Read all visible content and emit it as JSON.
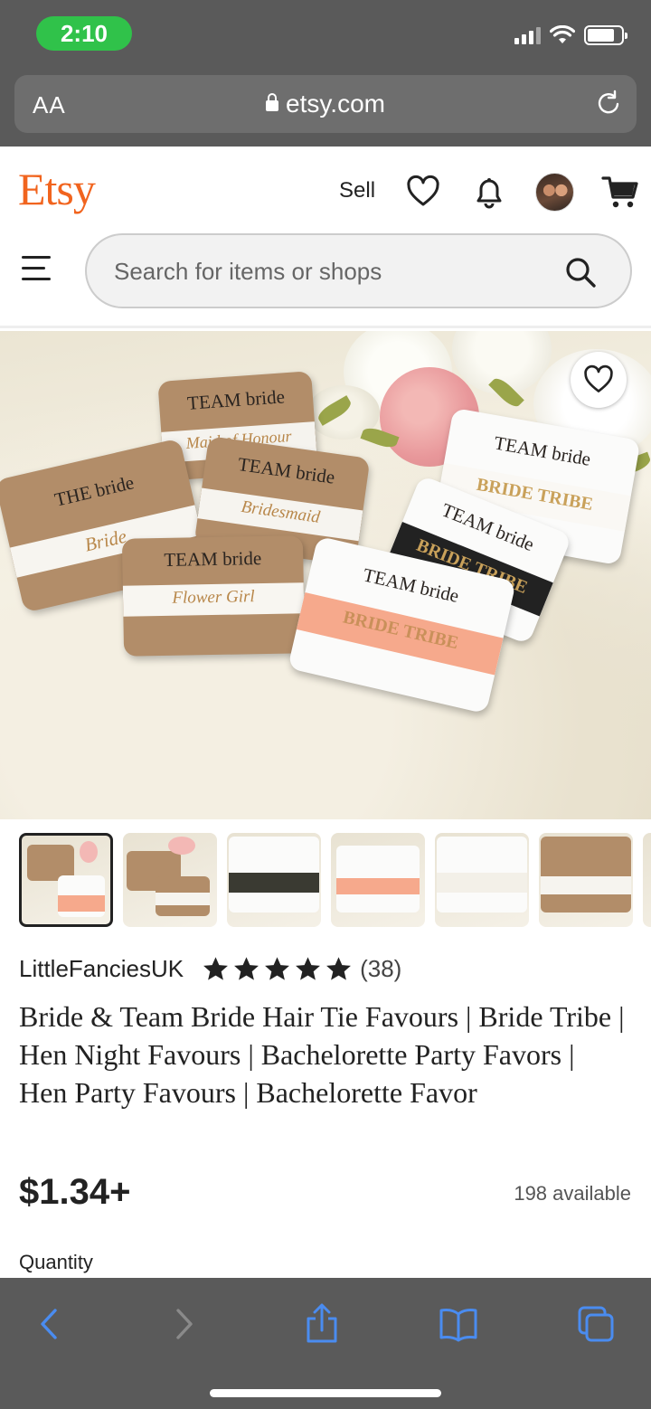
{
  "status_bar": {
    "time": "2:10"
  },
  "browser": {
    "text_size_label": "AA",
    "url": "etsy.com"
  },
  "header": {
    "logo": "Etsy",
    "sell_label": "Sell",
    "search_placeholder": "Search for items or shops"
  },
  "gallery": {
    "image_texts": [
      "TEAM bride",
      "Maid of Honour",
      "THE bride",
      "Bride",
      "TEAM bride",
      "Bridesmaid",
      "TEAM bride",
      "Flower Girl",
      "TEAM bride",
      "BRIDE TRIBE",
      "TEAM bride",
      "BRIDE TRIBE",
      "TEAM bride",
      "BRIDE TRIBE"
    ],
    "thumbnail_count": 7,
    "selected_thumbnail": 1
  },
  "product": {
    "shop_name": "LittleFanciesUK",
    "rating_stars": 5,
    "review_count": "(38)",
    "title": "Bride & Team Bride Hair Tie Favours | Bride Tribe | Hen Night Favours | Bachelorette Party Favors | Hen Party Favours | Bachelorette Favor",
    "price": "$1.34+",
    "availability": "198 available",
    "quantity_label": "Quantity"
  },
  "colors": {
    "etsy_orange": "#f1641e",
    "safari_chrome": "#5a5a5a",
    "status_green": "#30c24a",
    "toolbar_blue": "#4a8cf0"
  }
}
